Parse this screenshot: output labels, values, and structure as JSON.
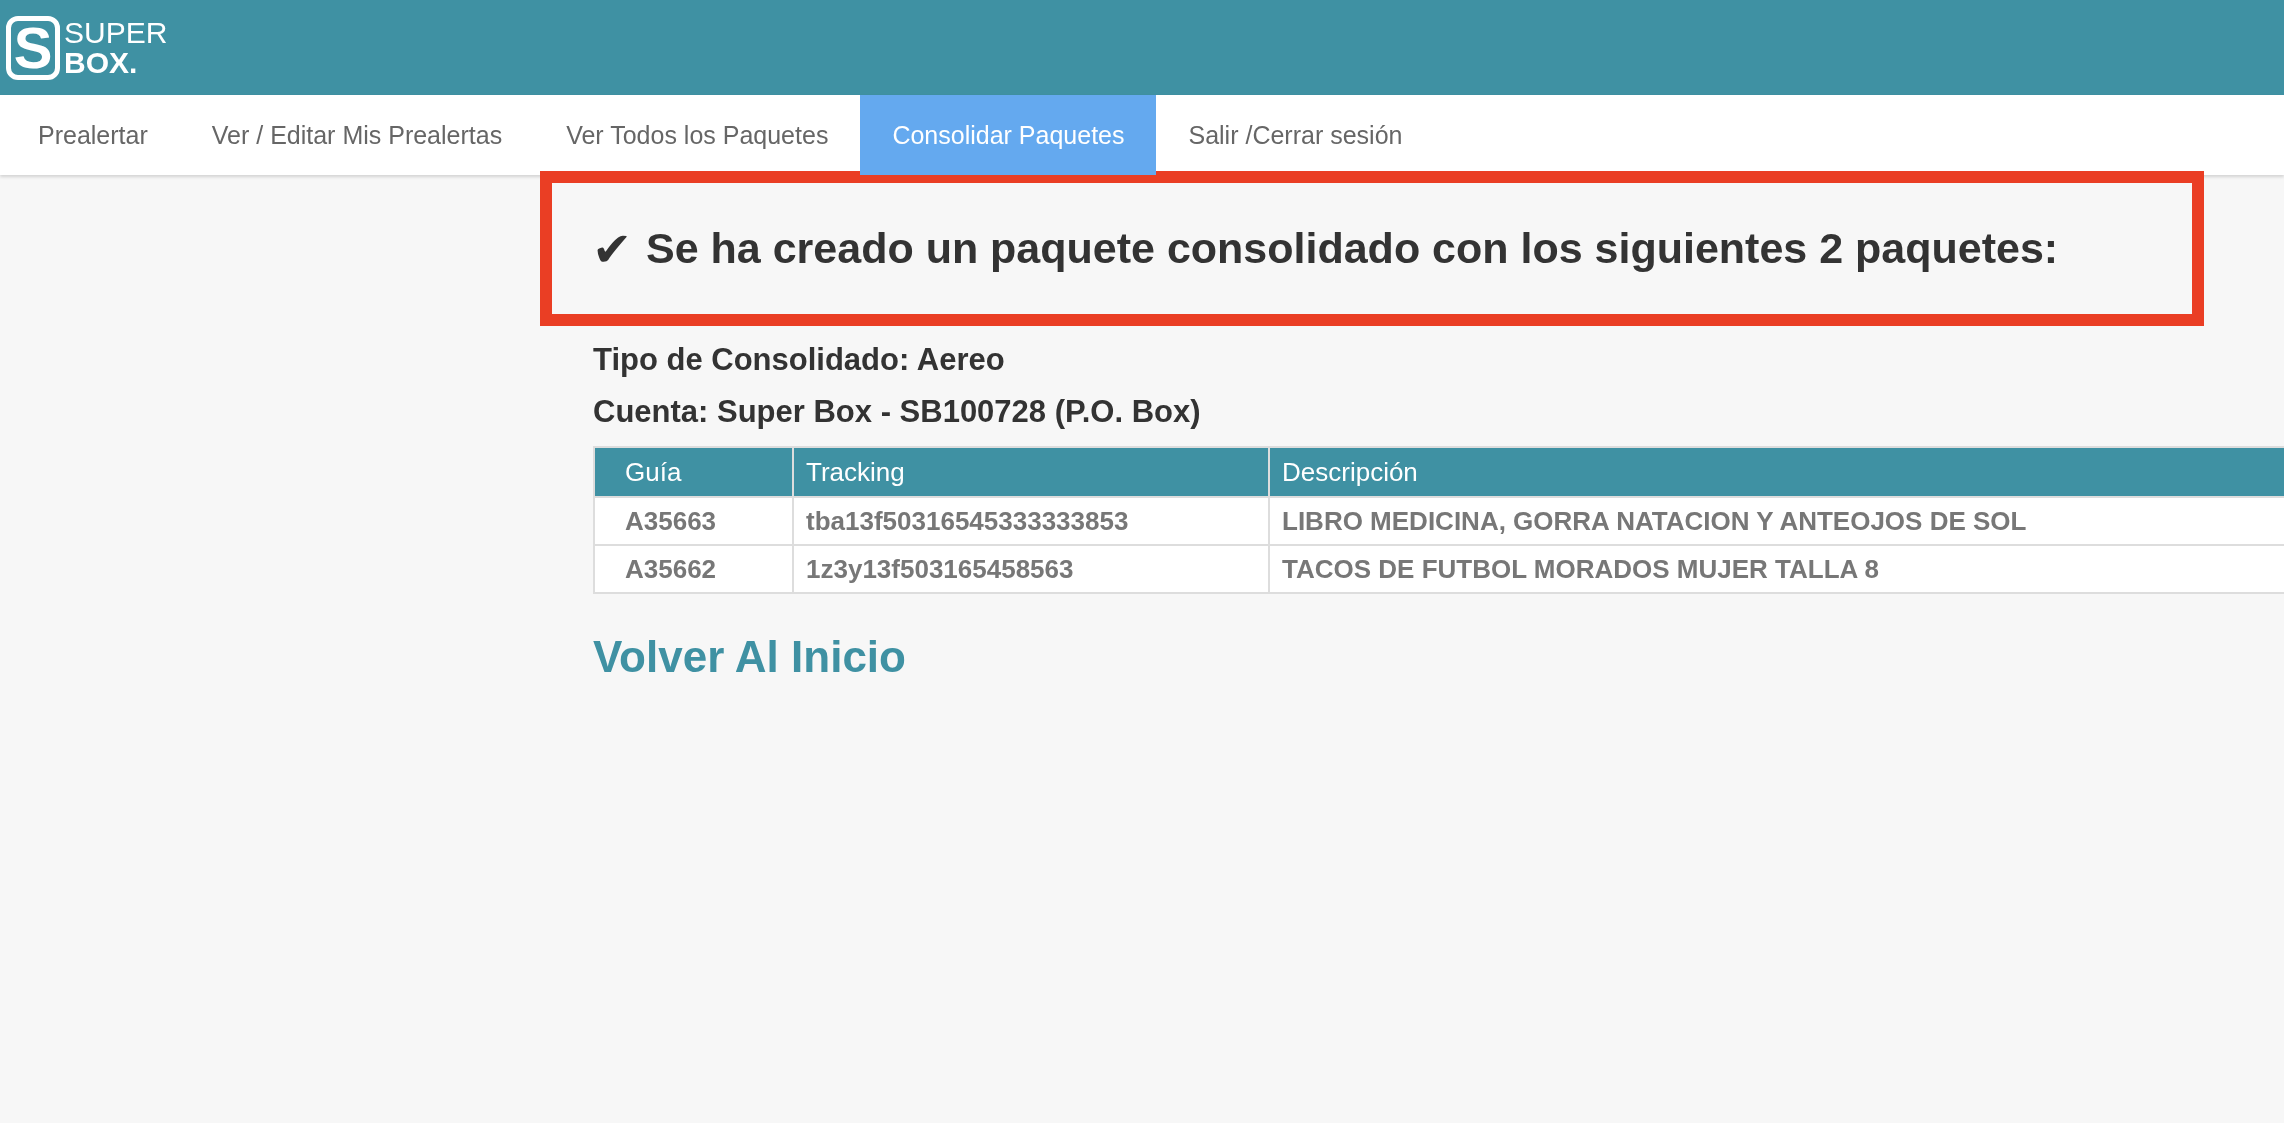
{
  "logo": {
    "mark": "S",
    "line_1": "SUPER",
    "line_2": "BOX."
  },
  "nav": [
    {
      "label": "Prealertar",
      "selected": false
    },
    {
      "label": "Ver / Editar Mis Prealertas",
      "selected": false
    },
    {
      "label": "Ver Todos los Paquetes",
      "selected": false
    },
    {
      "label": "Consolidar Paquetes",
      "selected": true
    },
    {
      "label": "Salir /Cerrar sesión",
      "selected": false
    }
  ],
  "message": {
    "icon": "✔",
    "text": "Se ha creado un paquete consolidado con los siguientes 2 paquetes:"
  },
  "details": [
    "Tipo de Consolidado: Aereo",
    "Cuenta: Super Box - SB100728 (P.O. Box)"
  ],
  "table": {
    "columns": [
      "Guía",
      "Tracking",
      "Descripción"
    ],
    "rows": [
      [
        "A35663",
        "tba13f50316545333333853",
        "LIBRO MEDICINA, GORRA NATACION Y ANTEOJOS DE SOL"
      ],
      [
        "A35662",
        "1z3y13f503165458563",
        "TACOS DE FUTBOL MORADOS MUJER TALLA 8"
      ]
    ]
  },
  "back_link": "Volver Al Inicio"
}
